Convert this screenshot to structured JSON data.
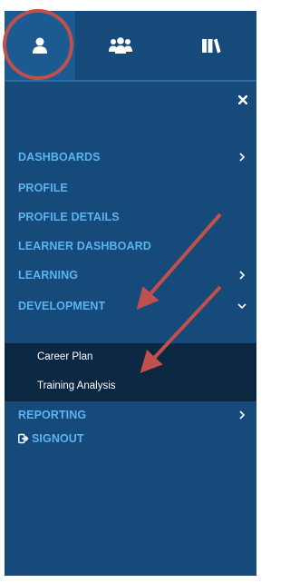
{
  "tabs": [
    {
      "icon": "user-icon",
      "active": true
    },
    {
      "icon": "group-icon",
      "active": false
    },
    {
      "icon": "library-icon",
      "active": false
    }
  ],
  "close_icon": "close-icon",
  "menu": {
    "dashboards": "DASHBOARDS",
    "profile": "PROFILE",
    "profile_details": "PROFILE DETAILS",
    "learner_dashboard": "LEARNER DASHBOARD",
    "learning": "LEARNING",
    "development": "DEVELOPMENT",
    "reporting": "REPORTING",
    "signout": "SIGNOUT"
  },
  "submenu": {
    "career_plan": "Career Plan",
    "training_analysis": "Training Analysis"
  },
  "colors": {
    "panel_bg": "#164a7a",
    "active_tab_bg": "#1c5a92",
    "submenu_bg": "#0b2742",
    "menu_text": "#5bb3f0",
    "annotation_red": "#c0504d"
  }
}
